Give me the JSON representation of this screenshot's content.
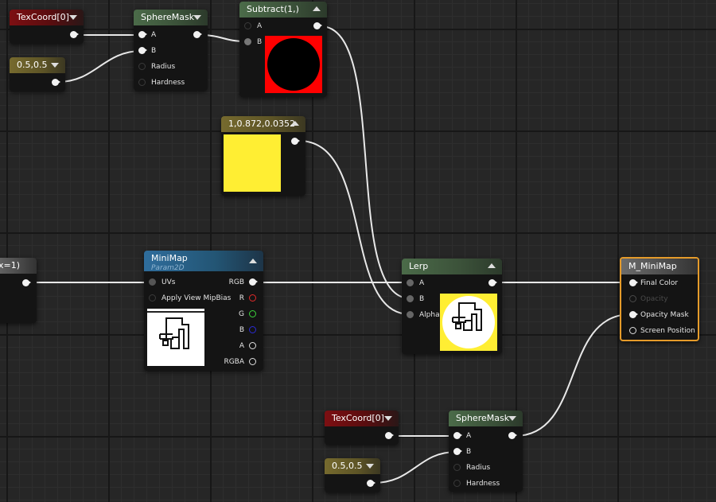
{
  "nodes": {
    "texcoord_top": {
      "title": "TexCoord[0]"
    },
    "const_top": {
      "title": "0.5,0.5"
    },
    "spheremask_top": {
      "title": "SphereMask",
      "pins": [
        "A",
        "B",
        "Radius",
        "Hardness"
      ]
    },
    "subtract": {
      "title": "Subtract(1,)",
      "pins": [
        "A",
        "B"
      ]
    },
    "color_const": {
      "title": "1,0.872,0.0352"
    },
    "left_partial": {
      "title": "x=1)"
    },
    "minimap": {
      "title": "MiniMap",
      "subtitle": "Param2D",
      "inputs": [
        "UVs",
        "Apply View MipBias"
      ],
      "outputs": [
        "RGB",
        "R",
        "G",
        "B",
        "A",
        "RGBA"
      ]
    },
    "lerp": {
      "title": "Lerp",
      "pins": [
        "A",
        "B",
        "Alpha"
      ]
    },
    "material": {
      "title": "M_MiniMap",
      "pins": [
        "Final Color",
        "Opacity",
        "Opacity Mask",
        "Screen Position"
      ]
    },
    "texcoord_bottom": {
      "title": "TexCoord[0]"
    },
    "const_bottom": {
      "title": "0.5,0.5"
    },
    "spheremask_bottom": {
      "title": "SphereMask",
      "pins": [
        "A",
        "B",
        "Radius",
        "Hardness"
      ]
    }
  },
  "colors": {
    "selected_outline": "#e59b2a",
    "preview_red": "#ff0000",
    "preview_yellow": "#ffee33",
    "wire": "#e8e8e8"
  },
  "icons": {
    "collapse": "triangle-down",
    "expand": "triangle-up",
    "map_glyph": "minimap-outline-icon"
  }
}
